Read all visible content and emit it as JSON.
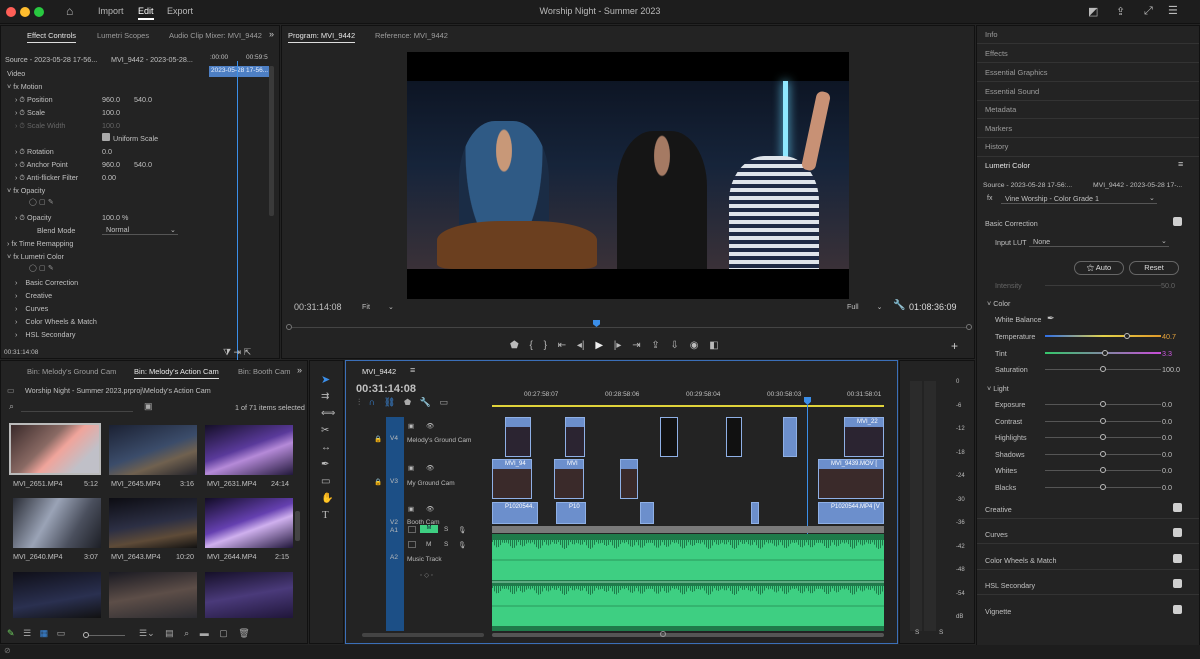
{
  "app": {
    "title": "Worship Night - Summer 2023",
    "menu": [
      "Import",
      "Edit",
      "Export"
    ],
    "active_menu": "Edit"
  },
  "effect_controls": {
    "tabs": [
      "Effect Controls",
      "Lumetri Scopes",
      "Audio Clip Mixer: MVI_9442"
    ],
    "source": "Source - 2023-05-28 17-56...",
    "clip": "MVI_9442 - 2023-05-28...",
    "mini_time_start": ":00:00",
    "mini_time_end": "00:59:5",
    "mini_clip": "2023-05-28 17-56...",
    "section": "Video",
    "motion": "Motion",
    "position_label": "Position",
    "position_x": "960.0",
    "position_y": "540.0",
    "scale_label": "Scale",
    "scale_val": "100.0",
    "scale_width_label": "Scale Width",
    "scale_width_val": "100.0",
    "uniform_scale": "Uniform Scale",
    "rotation_label": "Rotation",
    "rotation_val": "0.0",
    "anchor_label": "Anchor Point",
    "anchor_x": "960.0",
    "anchor_y": "540.0",
    "antiflicker_label": "Anti-flicker Filter",
    "antiflicker_val": "0.00",
    "opacity_section": "Opacity",
    "opacity_label": "Opacity",
    "opacity_val": "100.0 %",
    "blend_label": "Blend Mode",
    "blend_val": "Normal",
    "time_remap": "Time Remapping",
    "lumetri": "Lumetri Color",
    "lumetri_items": [
      "Basic Correction",
      "Creative",
      "Curves",
      "Color Wheels & Match",
      "HSL Secondary"
    ],
    "timecode": "00:31:14:08"
  },
  "program": {
    "tab": "Program: MVI_9442",
    "reference_tab": "Reference: MVI_9442",
    "timecode": "00:31:14:08",
    "fit": "Fit",
    "full": "Full",
    "duration": "01:08:36:09"
  },
  "project": {
    "tabs": [
      "Bin: Melody's Ground Cam",
      "Bin: Melody's Action Cam",
      "Bin: Booth Cam"
    ],
    "active_tab": "Bin: Melody's Action Cam",
    "path": "Worship Night - Summer 2023.prproj\\Melody's Action Cam",
    "count": "1 of 71 items selected",
    "clips": [
      {
        "name": "MVI_2651.MP4",
        "dur": "5:12"
      },
      {
        "name": "MVI_2645.MP4",
        "dur": "3:16"
      },
      {
        "name": "MVI_2631.MP4",
        "dur": "24:14"
      },
      {
        "name": "MVI_2640.MP4",
        "dur": "3:07"
      },
      {
        "name": "MVI_2643.MP4",
        "dur": "10:20"
      },
      {
        "name": "MVI_2644.MP4",
        "dur": "2:15"
      }
    ]
  },
  "timeline": {
    "tab": "MVI_9442",
    "timecode": "00:31:14:08",
    "ruler": [
      "00:27:58:07",
      "00:28:58:06",
      "00:29:58:04",
      "00:30:58:03",
      "00:31:58:01"
    ],
    "tracks": [
      {
        "id": "V4",
        "name": "Melody's Ground Cam"
      },
      {
        "id": "V3",
        "name": "My Ground Cam"
      },
      {
        "id": "V2",
        "name": "Booth Cam"
      },
      {
        "id": "A1",
        "name": ""
      },
      {
        "id": "A2",
        "name": "Music Track"
      }
    ],
    "clip_labels": [
      "MVI_22",
      "MVI_94",
      "MVI",
      "MVI_9439.MOV [",
      "P1020544.",
      "P10",
      "P1020544.MP4 [V"
    ],
    "meter_ticks": [
      "0",
      "-6",
      "-12",
      "-18",
      "-24",
      "-30",
      "-36",
      "-42",
      "-48",
      "-54",
      "dB"
    ]
  },
  "right_panel": {
    "items": [
      "Info",
      "Effects",
      "Essential Graphics",
      "Essential Sound",
      "Metadata",
      "Markers",
      "History"
    ],
    "lumetri_title": "Lumetri Color",
    "source": "Source - 2023-05-28 17-56:...",
    "clip": "MVI_9442 - 2023-05-28 17-...",
    "preset": "Vine Worship - Color Grade 1",
    "basic_correction": "Basic Correction",
    "input_lut_label": "Input LUT",
    "input_lut_val": "None",
    "auto": "Auto",
    "reset": "Reset",
    "intensity_label": "Intensity",
    "intensity_val": "50.0",
    "color_section": "Color",
    "white_balance": "White Balance",
    "temperature_label": "Temperature",
    "temperature_val": "40.7",
    "tint_label": "Tint",
    "tint_val": "3.3",
    "saturation_label": "Saturation",
    "saturation_val": "100.0",
    "light_section": "Light",
    "light_sliders": [
      {
        "label": "Exposure",
        "val": "0.0"
      },
      {
        "label": "Contrast",
        "val": "0.0"
      },
      {
        "label": "Highlights",
        "val": "0.0"
      },
      {
        "label": "Shadows",
        "val": "0.0"
      },
      {
        "label": "Whites",
        "val": "0.0"
      },
      {
        "label": "Blacks",
        "val": "0.0"
      }
    ],
    "sections": [
      "Creative",
      "Curves",
      "Color Wheels & Match",
      "HSL Secondary",
      "Vignette"
    ]
  },
  "colors": {
    "accent": "#3b8ee8",
    "audio": "#3ecf82",
    "video_clip": "#6c8fcc"
  }
}
